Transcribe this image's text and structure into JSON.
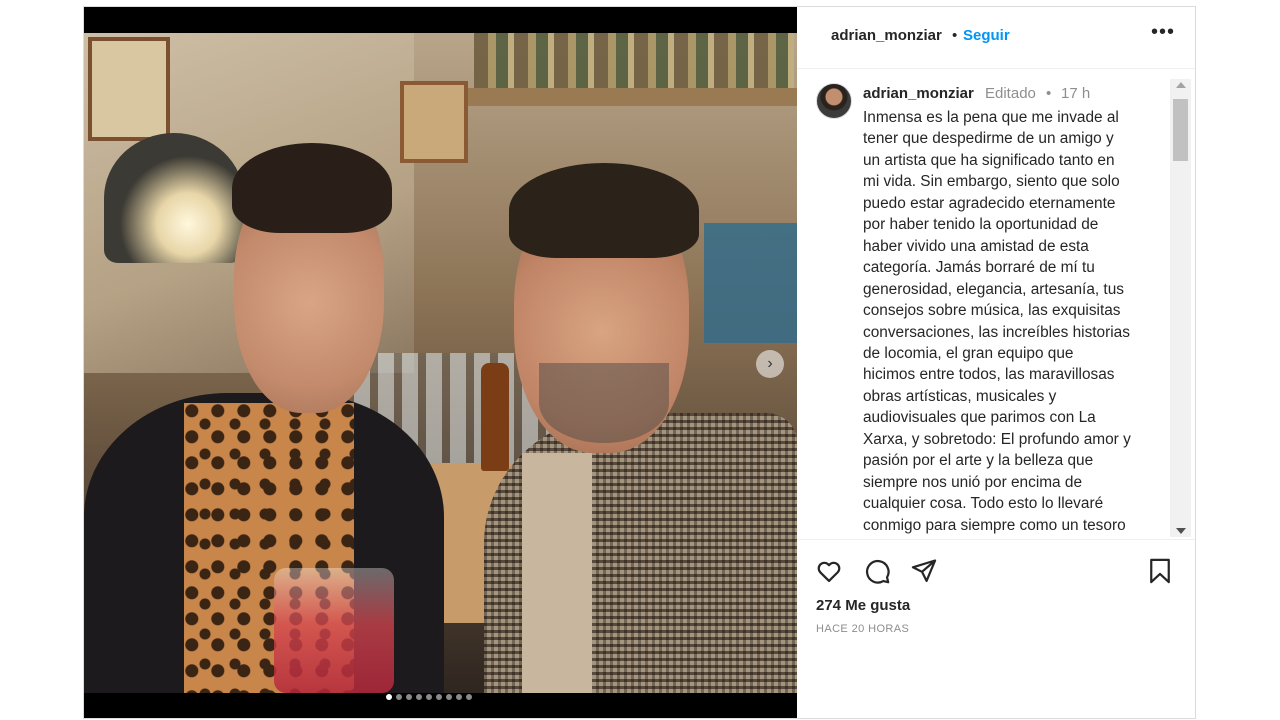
{
  "post": {
    "username": "adrian_monziar",
    "follow_label": "Seguir",
    "separator": "•",
    "more_label": "•••"
  },
  "caption": {
    "username": "adrian_monziar",
    "edited_label": "Editado",
    "separator": "•",
    "time": "17 h",
    "lines": [
      "Inmensa es la pena que me invade al",
      "tener que despedirme de un amigo y",
      "un artista que ha significado tanto en",
      "mi vida. Sin embargo, siento que solo",
      "puedo estar agradecido eternamente",
      "por haber tenido la oportunidad de",
      "haber vivido una amistad de esta",
      "categoría. Jamás borraré de mí tu",
      "generosidad, elegancia, artesanía, tus",
      "consejos sobre música, las exquisitas",
      "conversaciones, las increíbles historias",
      "de locomia, el gran equipo que",
      "hicimos entre todos, las maravillosas",
      "obras artísticas, musicales y",
      "audiovisuales que parimos con La",
      "Xarxa, y sobretodo: El profundo amor y",
      "pasión por el arte y la belleza que",
      "siempre nos unió por encima de",
      "cualquier cosa. Todo esto lo llevaré",
      "conmigo para siempre como un tesoro"
    ]
  },
  "engagement": {
    "likes": "274 Me gusta",
    "posted_ago": "HACE 20 HORAS"
  },
  "carousel": {
    "slide_count": 9,
    "active_index": 0
  },
  "colors": {
    "follow": "#0095f6",
    "text": "#262626",
    "muted": "#8e8e8e"
  },
  "icons": [
    "heart-icon",
    "comment-icon",
    "share-icon",
    "bookmark-icon",
    "chevron-right-icon",
    "more-icon"
  ]
}
